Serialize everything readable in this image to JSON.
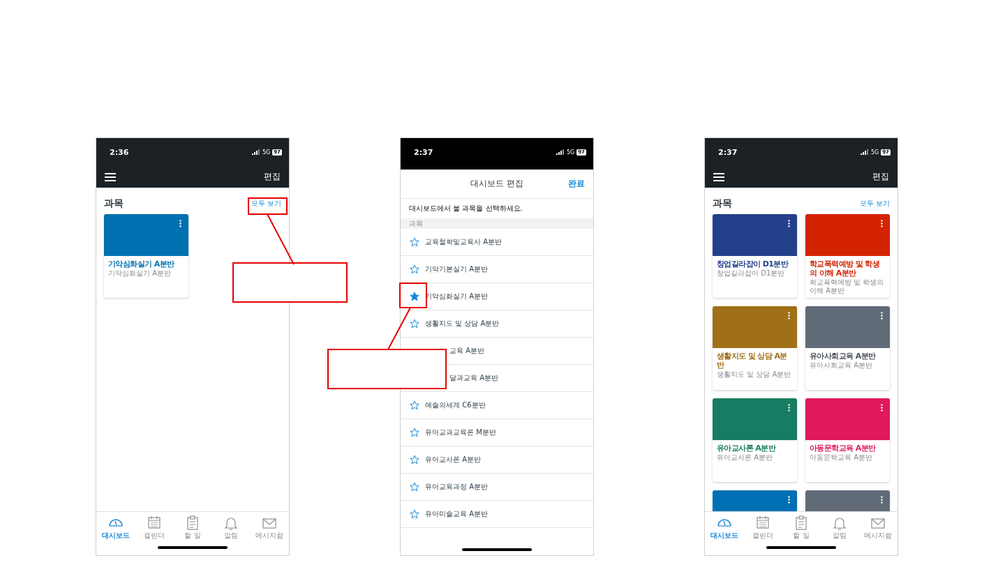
{
  "phones": [
    {
      "kind": "dashboard",
      "status": {
        "time": "2:36",
        "network": "5G",
        "battery": "97"
      },
      "header": {
        "action": "편집"
      },
      "section": {
        "title": "과목",
        "link": "모두 보기"
      },
      "courses": [
        {
          "title": "기악심화실기 A분반",
          "subtitle": "기악심화실기 A분반",
          "color": "#0070b0"
        }
      ],
      "tabs": [
        {
          "label": "대시보드",
          "selected": true
        },
        {
          "label": "캘린더",
          "selected": false
        },
        {
          "label": "할 일",
          "selected": false
        },
        {
          "label": "알림",
          "selected": false
        },
        {
          "label": "메시지함",
          "selected": false
        }
      ]
    },
    {
      "kind": "edit_sheet",
      "status": {
        "time": "2:37",
        "network": "5G",
        "battery": "97"
      },
      "sheet": {
        "title": "대시보드 편집",
        "done": "완료",
        "instruction": "대시보드에서 볼 과목을 선택하세요.",
        "section": "과목",
        "courses": [
          {
            "name": "교육철학및교육사 A분반",
            "starred": false
          },
          {
            "name": "기악기본실기 A분반",
            "starred": false
          },
          {
            "name": "기악심화실기 A분반",
            "starred": true
          },
          {
            "name": "생활지도 및 상담 A분반",
            "starred": false
          },
          {
            "name": "교육 A분반",
            "kind": "covered"
          },
          {
            "name": "달과교육 A분반",
            "kind": "covered"
          },
          {
            "name": "예술의세계 C6분반",
            "starred": false
          },
          {
            "name": "유아교과교육론 M분반",
            "starred": false
          },
          {
            "name": "유아교사론 A분반",
            "starred": false
          },
          {
            "name": "유아교육과정 A분반",
            "starred": false
          },
          {
            "name": "유아미술교육 A분반",
            "starred": false
          }
        ]
      }
    },
    {
      "kind": "dashboard",
      "status": {
        "time": "2:37",
        "network": "5G",
        "battery": "97"
      },
      "header": {
        "action": "편집"
      },
      "section": {
        "title": "과목",
        "link": "모두 보기"
      },
      "courses": [
        {
          "title": "창업길라잡이 D1분반",
          "subtitle": "창업길라잡이 D1분반",
          "color": "#24408a"
        },
        {
          "title": "학교폭력예방 및 학생의 이해 A분반",
          "subtitle": "학교폭력예방 및 학생의 이해 A분반",
          "color": "#d42300"
        },
        {
          "title": "생활지도 및 상담 A분반",
          "subtitle": "생활지도 및 상담 A분반",
          "color": "#a07018"
        },
        {
          "title": "유아사회교육 A분반",
          "subtitle": "유아사회교육 A분반",
          "color": "#616b78"
        },
        {
          "title": "유아교사론 A분반",
          "subtitle": "유아교사론 A분반",
          "color": "#177d62"
        },
        {
          "title": "아동문학교육 A분반",
          "subtitle": "아동문학교육 A분반",
          "color": "#e0195a"
        },
        {
          "color": "#0070b4"
        },
        {
          "color": "#616b78"
        }
      ],
      "tabs": [
        {
          "label": "대시보드",
          "selected": true
        },
        {
          "label": "캘린더",
          "selected": false
        },
        {
          "label": "할 일",
          "selected": false
        },
        {
          "label": "알림",
          "selected": false
        },
        {
          "label": "메시지함",
          "selected": false
        }
      ]
    }
  ]
}
